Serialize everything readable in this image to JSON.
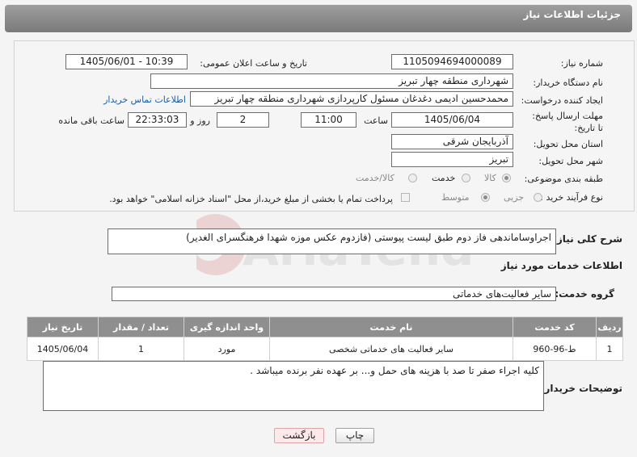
{
  "header": {
    "title": "جزئیات اطلاعات نیاز"
  },
  "fields": {
    "need_number_label": "شماره نیاز:",
    "need_number": "1105094694000089",
    "announce_label": "تاریخ و ساعت اعلان عمومی:",
    "announce_value": "1405/06/01 - 10:39",
    "buyer_org_label": "نام دستگاه خریدار:",
    "buyer_org": "شهرداری منطقه چهار تبریز",
    "creator_label": "ایجاد کننده درخواست:",
    "creator": "محمدحسین ادیمی دغدغان مسئول کارپردازی شهرداری منطقه چهار تبریز",
    "contact_link": "اطلاعات تماس خریدار",
    "deadline_label": "مهلت ارسال پاسخ: تا تاریخ:",
    "deadline_date": "1405/06/04",
    "time_label": "ساعت",
    "deadline_time": "11:00",
    "days_value": "2",
    "days_label": "روز و",
    "remaining_time": "22:33:03",
    "remaining_label": "ساعت باقی مانده",
    "province_label": "استان محل تحویل:",
    "province": "آذربایجان شرقی",
    "city_label": "شهر محل تحویل:",
    "city": "تبریز",
    "category_label": "طبقه بندی موضوعی:",
    "category_options": [
      "کالا",
      "خدمت",
      "کالا/خدمت"
    ],
    "category_selected": "خدمت",
    "process_label": "نوع فرآیند خرید :",
    "process_options": [
      "جزیی",
      "متوسط"
    ],
    "process_selected": "جزیی",
    "payment_note": "پرداخت تمام یا بخشی از مبلغ خرید،از محل \"اسناد خزانه اسلامی\" خواهد بود."
  },
  "summary": {
    "label": "شرح کلی نیاز:",
    "text": "اجراوساماندهی فاز دوم طبق لیست پیوستی (فازدوم عکس موزه شهدا فرهنگسرای الغدیر)"
  },
  "services": {
    "section_title": "اطلاعات خدمات مورد نیاز",
    "group_label": "گروه خدمت:",
    "group_value": "سایر فعالیت‌های خدماتی",
    "columns": [
      "ردیف",
      "کد خدمت",
      "نام خدمت",
      "واحد اندازه گیری",
      "تعداد / مقدار",
      "تاریخ نیاز"
    ],
    "rows": [
      [
        "1",
        "ط-96-960",
        "سایر فعالیت های خدماتی شخصی",
        "مورد",
        "1",
        "1405/06/04"
      ]
    ]
  },
  "buyer_notes": {
    "label": "توضیحات خریدار:",
    "text": "کلیه اجراء صفر تا صد با هزینه های حمل و... بر عهده نفر برنده میباشد ."
  },
  "buttons": {
    "print": "چاپ",
    "back": "بازگشت"
  },
  "watermark": {
    "text": "AriaTender.net"
  },
  "colors": {
    "header": "#8a8a8a",
    "link": "#1a5ea8",
    "table_header": "#8f8f8f",
    "back_button": "#fde9e9"
  }
}
